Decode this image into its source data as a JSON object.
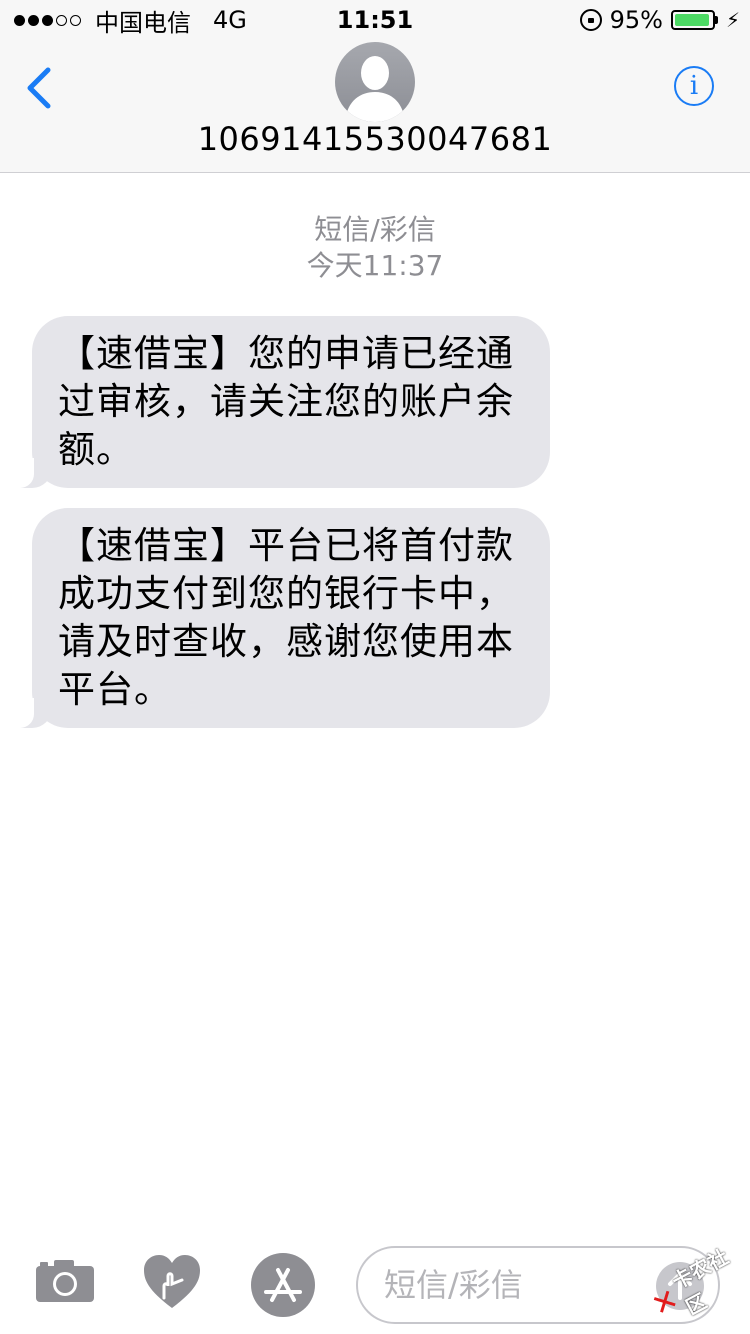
{
  "status_bar": {
    "carrier": "中国电信",
    "network": "4G",
    "time": "11:51",
    "battery_percent": "95%",
    "battery_level": 0.95,
    "signal_filled": 3,
    "signal_total": 5
  },
  "nav": {
    "contact": "10691415530047681",
    "back_icon": "chevron-left-icon",
    "info_icon": "info-icon",
    "info_glyph": "i"
  },
  "conversation": {
    "type_label": "短信/彩信",
    "timestamp": "今天11:37"
  },
  "messages": [
    {
      "text": "【速借宝】您的申请已经通过审核，请关注您的账户余额。"
    },
    {
      "text": "【速借宝】平台已将首付款成功支付到您的银行卡中，请及时查收，感谢您使用本平台。"
    }
  ],
  "input_bar": {
    "placeholder": "短信/彩信",
    "camera_icon": "camera-icon",
    "heart_icon": "digital-touch-icon",
    "apps_icon": "app-store-icon",
    "send_icon": "send-arrow-icon"
  },
  "watermark": {
    "text": "卡农社区"
  },
  "colors": {
    "accent": "#1a7cf5",
    "bubble": "#e5e5ea",
    "secondary_text": "#8e8e93",
    "battery": "#4cd964"
  }
}
